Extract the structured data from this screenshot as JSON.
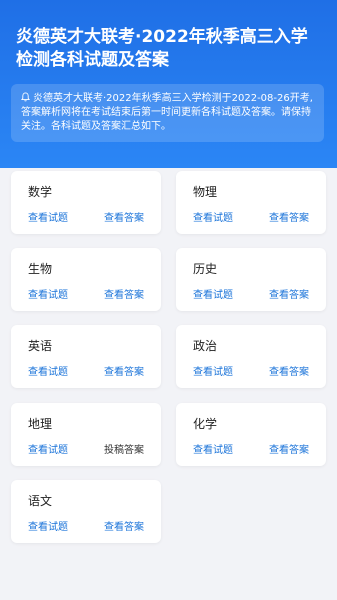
{
  "header": {
    "title": "炎德英才大联考·2022年秋季高三入学检测各科试题及答案",
    "notice": "炎德英才大联考·2022年秋季高三入学检测于2022-08-26开考,答案解析网将在考试结束后第一时间更新各科试题及答案。请保持关注。各科试题及答案汇总如下。"
  },
  "subjects": [
    {
      "name": "数学",
      "left_link": "查看试题",
      "right_link": "查看答案"
    },
    {
      "name": "物理",
      "left_link": "查看试题",
      "right_link": "查看答案"
    },
    {
      "name": "生物",
      "left_link": "查看试题",
      "right_link": "查看答案"
    },
    {
      "name": "历史",
      "left_link": "查看试题",
      "right_link": "查看答案"
    },
    {
      "name": "英语",
      "left_link": "查看试题",
      "right_link": "查看答案"
    },
    {
      "name": "政治",
      "left_link": "查看试题",
      "right_link": "查看答案"
    },
    {
      "name": "地理",
      "left_link": "查看试题",
      "right_link": "投稿答案"
    },
    {
      "name": "化学",
      "left_link": "查看试题",
      "right_link": "查看答案"
    },
    {
      "name": "语文",
      "left_link": "查看试题",
      "right_link": "查看答案"
    }
  ]
}
